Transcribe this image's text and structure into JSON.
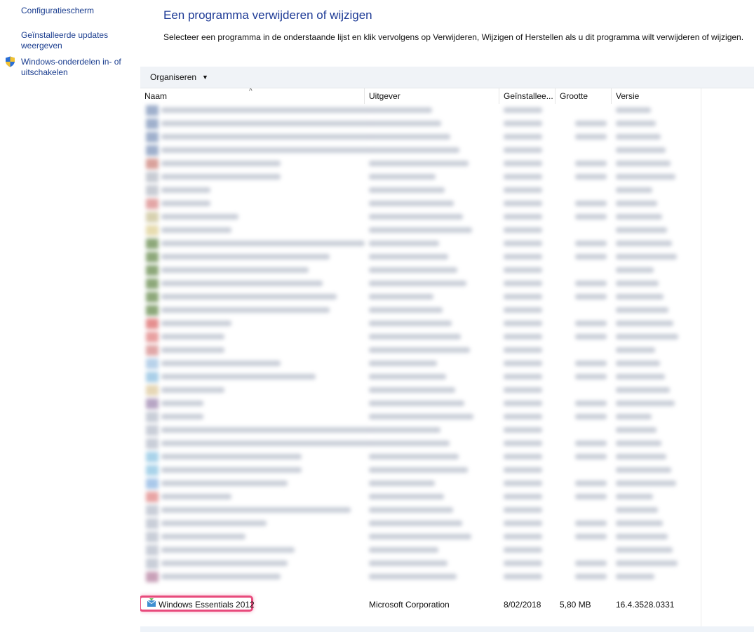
{
  "sidebar": {
    "links": [
      {
        "label": "Configuratiescherm"
      },
      {
        "label_line1": "Geïnstalleerde updates",
        "label_line2": "weergeven"
      },
      {
        "label_line1": "Windows-onderdelen in- of",
        "label_line2": "uitschakelen",
        "icon": "shield-icon"
      }
    ]
  },
  "main": {
    "title": "Een programma verwijderen of wijzigen",
    "description": "Selecteer een programma in de onderstaande lijst en klik vervolgens op Verwijderen, Wijzigen of Herstellen als u dit programma wilt verwijderen of wijzigen."
  },
  "toolbar": {
    "organize_label": "Organiseren",
    "organize_icon": "chevron-down-icon"
  },
  "table": {
    "columns": [
      "Naam",
      "Uitgever",
      "Geïnstallee...",
      "Grootte",
      "Versie"
    ],
    "sorted_column": "Naam",
    "highlighted_row": {
      "name": "Windows Essentials 2012",
      "publisher": "Microsoft Corporation",
      "installed": "8/02/2018",
      "size": "5,80 MB",
      "version": "16.4.3528.0331",
      "highlight_color": "#e84a7c"
    }
  },
  "colors": {
    "link": "#1a3d8f",
    "title": "#1e3b96",
    "toolbar_bg": "#f0f3f7"
  }
}
